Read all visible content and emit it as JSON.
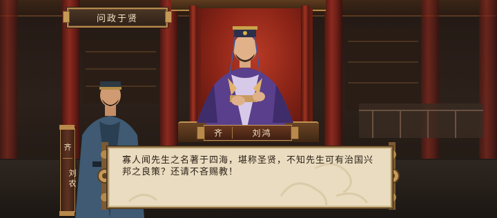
{
  "scene": {
    "title": "问政于贤"
  },
  "center_character": {
    "faction": "齐",
    "name": "刘鸿"
  },
  "speaker": {
    "faction": "齐",
    "name": "刘农"
  },
  "dialogue": {
    "text": "寡人闻先生之名著于四海，堪称圣贤，不知先生可有治国兴邦之良策？还请不吝赐教！"
  },
  "colors": {
    "parchment": "#e9dcc0",
    "gold_trim": "#b48a4e",
    "crimson": "#8a2417",
    "text_light": "#f1e2c3",
    "text_dark": "#2c2118"
  }
}
